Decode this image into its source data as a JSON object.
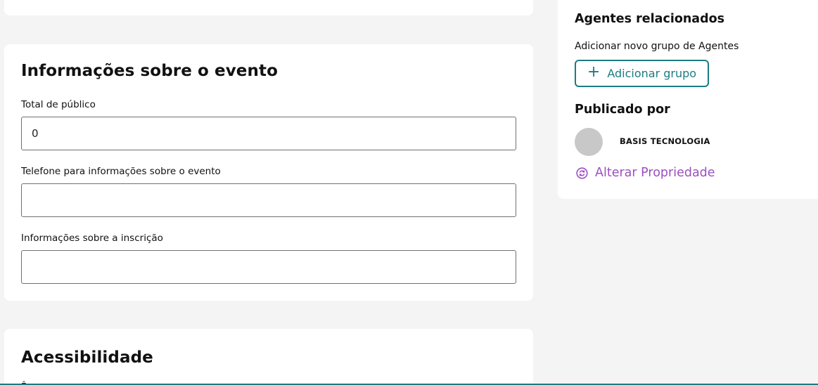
{
  "event_info": {
    "title": "Informações sobre o evento",
    "audience_label": "Total de público",
    "audience_value": "0",
    "phone_label": "Telefone para informações sobre o evento",
    "phone_value": "",
    "registration_label": "Informações sobre a inscrição",
    "registration_value": ""
  },
  "accessibility": {
    "title": "Acessibilidade",
    "cut_text": "Ê"
  },
  "sidebar": {
    "related_agents_title": "Agentes relacionados",
    "add_group_hint": "Adicionar novo grupo de Agentes",
    "add_group_button": "Adicionar grupo",
    "published_by_title": "Publicado por",
    "publisher_name": "BASIS TECNOLOGIA",
    "change_owner_link": "Alterar Propriedade"
  },
  "colors": {
    "page_bg": "#f4f4f4",
    "card_bg": "#ffffff",
    "accent_teal": "#1c7c80",
    "link_purple": "#9b4fc0",
    "avatar_gray": "#c8c8c8"
  },
  "icons": {
    "add_group": "plus-icon",
    "change_owner": "refresh-circle-icon"
  }
}
